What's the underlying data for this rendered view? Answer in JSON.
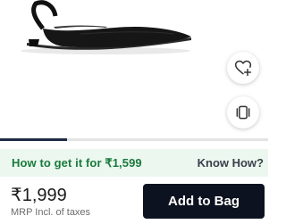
{
  "product": {
    "image_alt": "black slingback flat shoe",
    "icons": {
      "wishlist": "heart-plus-icon",
      "similar": "stacked-cards-icon"
    }
  },
  "carousel": {
    "current_index": 1,
    "total": 4
  },
  "offer": {
    "text": "How to get it for ₹1,599",
    "link_label": "Know How?"
  },
  "pricing": {
    "price": "₹1,999",
    "mrp_note": "MRP Incl. of taxes"
  },
  "actions": {
    "add_to_bag_label": "Add to Bag"
  },
  "colors": {
    "offer_bg": "#ecf7ef",
    "offer_text": "#1a7a3c",
    "button_bg": "#0c1220",
    "button_text": "#ffffff"
  }
}
